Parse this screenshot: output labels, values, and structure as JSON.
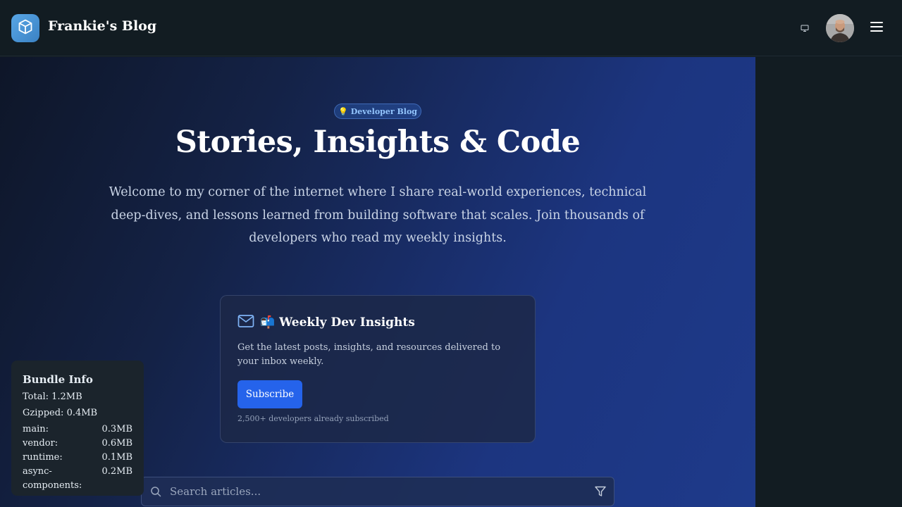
{
  "header": {
    "site_title": "Frankie's Blog",
    "logo_icon": "cube-icon",
    "monitor_icon": "monitor-icon",
    "menu_icon": "hamburger-menu-icon"
  },
  "hero": {
    "badge_emoji": "💡",
    "badge_label": "Developer Blog",
    "title": "Stories, Insights & Code",
    "description": "Welcome to my corner of the internet where I share real-world experiences, technical deep-dives, and lessons learned from building software that scales. Join thousands of developers who read my weekly insights."
  },
  "newsletter": {
    "title": "📬 Weekly Dev Insights",
    "description": "Get the latest posts, insights, and resources delivered to your inbox weekly.",
    "subscribe_label": "Subscribe",
    "subscriber_count": "2,500+ developers already subscribed"
  },
  "search": {
    "placeholder": "Search articles..."
  },
  "bundle_info": {
    "title": "Bundle Info",
    "total": "Total: 1.2MB",
    "gzipped": "Gzipped: 0.4MB",
    "chunks": [
      {
        "name": "main:",
        "size": "0.3MB"
      },
      {
        "name": "vendor:",
        "size": "0.6MB"
      },
      {
        "name": "runtime:",
        "size": "0.1MB"
      },
      {
        "name": "async-components:",
        "size": "0.2MB"
      }
    ]
  },
  "colors": {
    "accent": "#2563eb",
    "logo": "#4a9ad6",
    "header_bg": "#121c22"
  }
}
